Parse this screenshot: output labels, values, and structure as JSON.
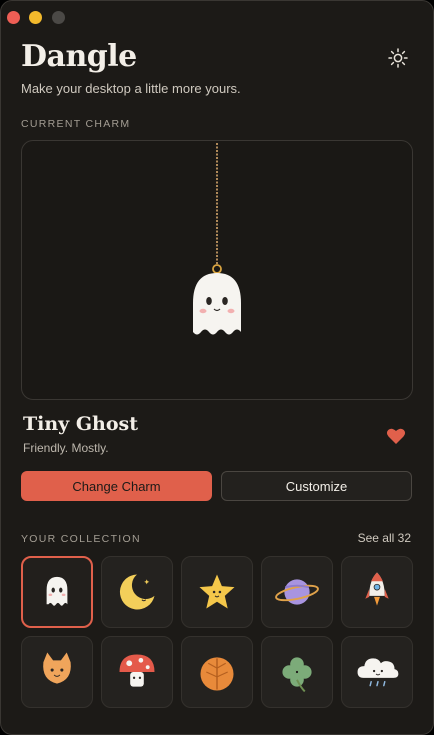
{
  "app": {
    "title": "Dangle",
    "subtitle": "Make your desktop a little more yours."
  },
  "current_charm": {
    "section_label": "CURRENT CHARM",
    "name": "Tiny Ghost",
    "description": "Friendly. Mostly.",
    "favorited": true
  },
  "actions": {
    "change_label": "Change Charm",
    "customize_label": "Customize"
  },
  "collection": {
    "section_label": "YOUR COLLECTION",
    "see_all_label": "See all 32",
    "items": [
      {
        "icon": "ghost-icon",
        "selected": true
      },
      {
        "icon": "moon-icon",
        "selected": false
      },
      {
        "icon": "star-icon",
        "selected": false
      },
      {
        "icon": "planet-icon",
        "selected": false
      },
      {
        "icon": "rocket-icon",
        "selected": false
      },
      {
        "icon": "cat-icon",
        "selected": false
      },
      {
        "icon": "mushroom-icon",
        "selected": false
      },
      {
        "icon": "leaf-icon",
        "selected": false
      },
      {
        "icon": "clover-icon",
        "selected": false
      },
      {
        "icon": "cloud-icon",
        "selected": false
      }
    ]
  },
  "colors": {
    "accent": "#e0604b",
    "background": "#1c1a17",
    "heart": "#e0604b"
  }
}
